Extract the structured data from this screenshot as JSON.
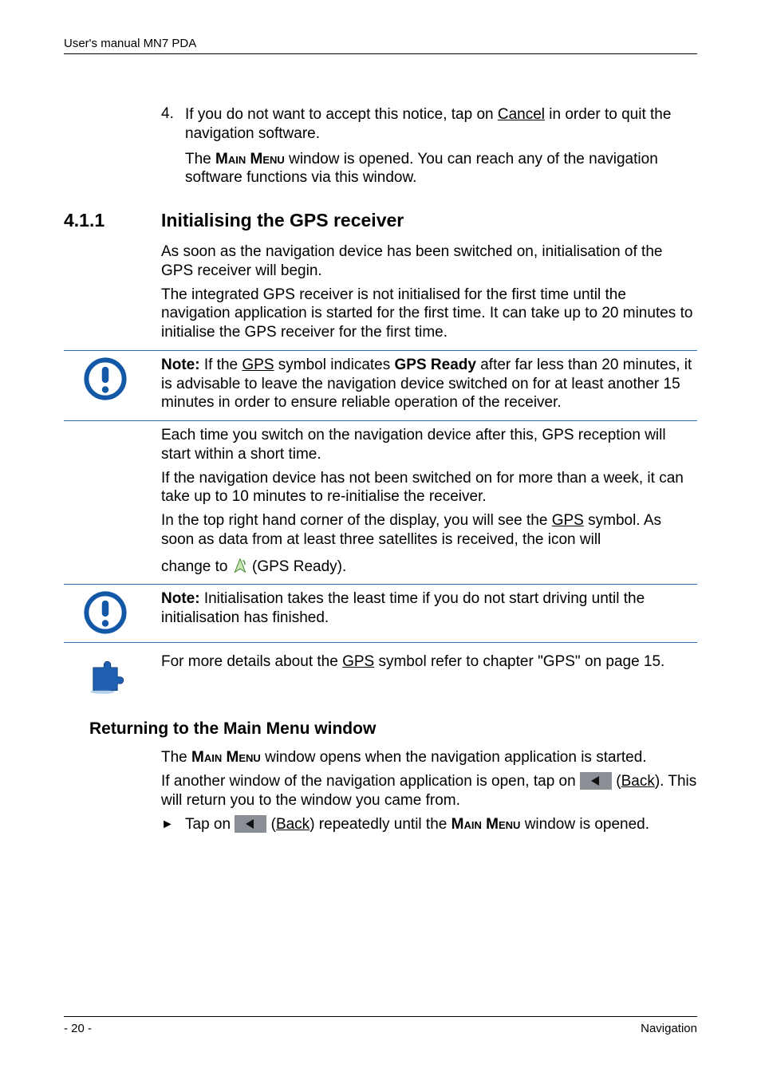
{
  "header": {
    "text": "User's manual MN7 PDA"
  },
  "ordered": {
    "num": "4.",
    "text_a": "If you do not want to accept this notice, tap on ",
    "cancel": "Cancel",
    "text_b": " in order to quit the navigation software.",
    "para2_a": "The ",
    "main_menu": "Main Menu",
    "para2_b": " window is opened. You can reach any of the navigation software functions via this window."
  },
  "h2": {
    "num": "4.1.1",
    "text": "Initialising the GPS receiver"
  },
  "p1": "As soon as the navigation device has been switched on, initialisation of the GPS receiver will begin.",
  "p2": "The integrated GPS receiver is not initialised for the first time until the navigation application is started for the first time. It can take up to 20 minutes to initialise the GPS receiver for the first time.",
  "note1": {
    "a": "Note:",
    "b": " If the ",
    "gps": "GPS",
    "c": " symbol indicates ",
    "ready": "GPS Ready",
    "d": " after far less than 20 minutes, it is advisable to leave the navigation device switched on for at least another 15 minutes in order to ensure reliable operation of the receiver."
  },
  "p3": "Each time you switch on the navigation device after this, GPS reception will start within a short time.",
  "p4": "If the navigation device has not been switched on for more than a week, it can take up to 10 minutes to re-initialise the receiver.",
  "p5": {
    "a": "In the top right hand corner of the display, you will see the ",
    "gps": "GPS",
    "b": " symbol. As soon as data from at least three satellites is received, the icon will"
  },
  "p6": {
    "a": "change to  ",
    "b": "  (GPS Ready)."
  },
  "note2": {
    "a": "Note:",
    "b": " Initialisation takes the least time if you do not start driving until the initialisation has finished."
  },
  "note3": {
    "a": "For more details about the ",
    "gps": "GPS",
    "b": " symbol refer to chapter \"GPS\" on page 15."
  },
  "h3": "Returning to the Main Menu window",
  "p7": {
    "a": "The ",
    "mm": "Main Menu",
    "b": " window opens when the navigation application is started."
  },
  "p8": {
    "a": "If another window of the navigation application is open, tap on ",
    "b": " (",
    "back": "Back",
    "c": "). This will return you to the window you came from."
  },
  "bullet": {
    "a": "Tap on ",
    "b": " (",
    "back": "Back",
    "c": ") repeatedly until the ",
    "mm": "Main Menu",
    "d": " window is opened."
  },
  "footer": {
    "page": "- 20 -",
    "section": "Navigation"
  }
}
